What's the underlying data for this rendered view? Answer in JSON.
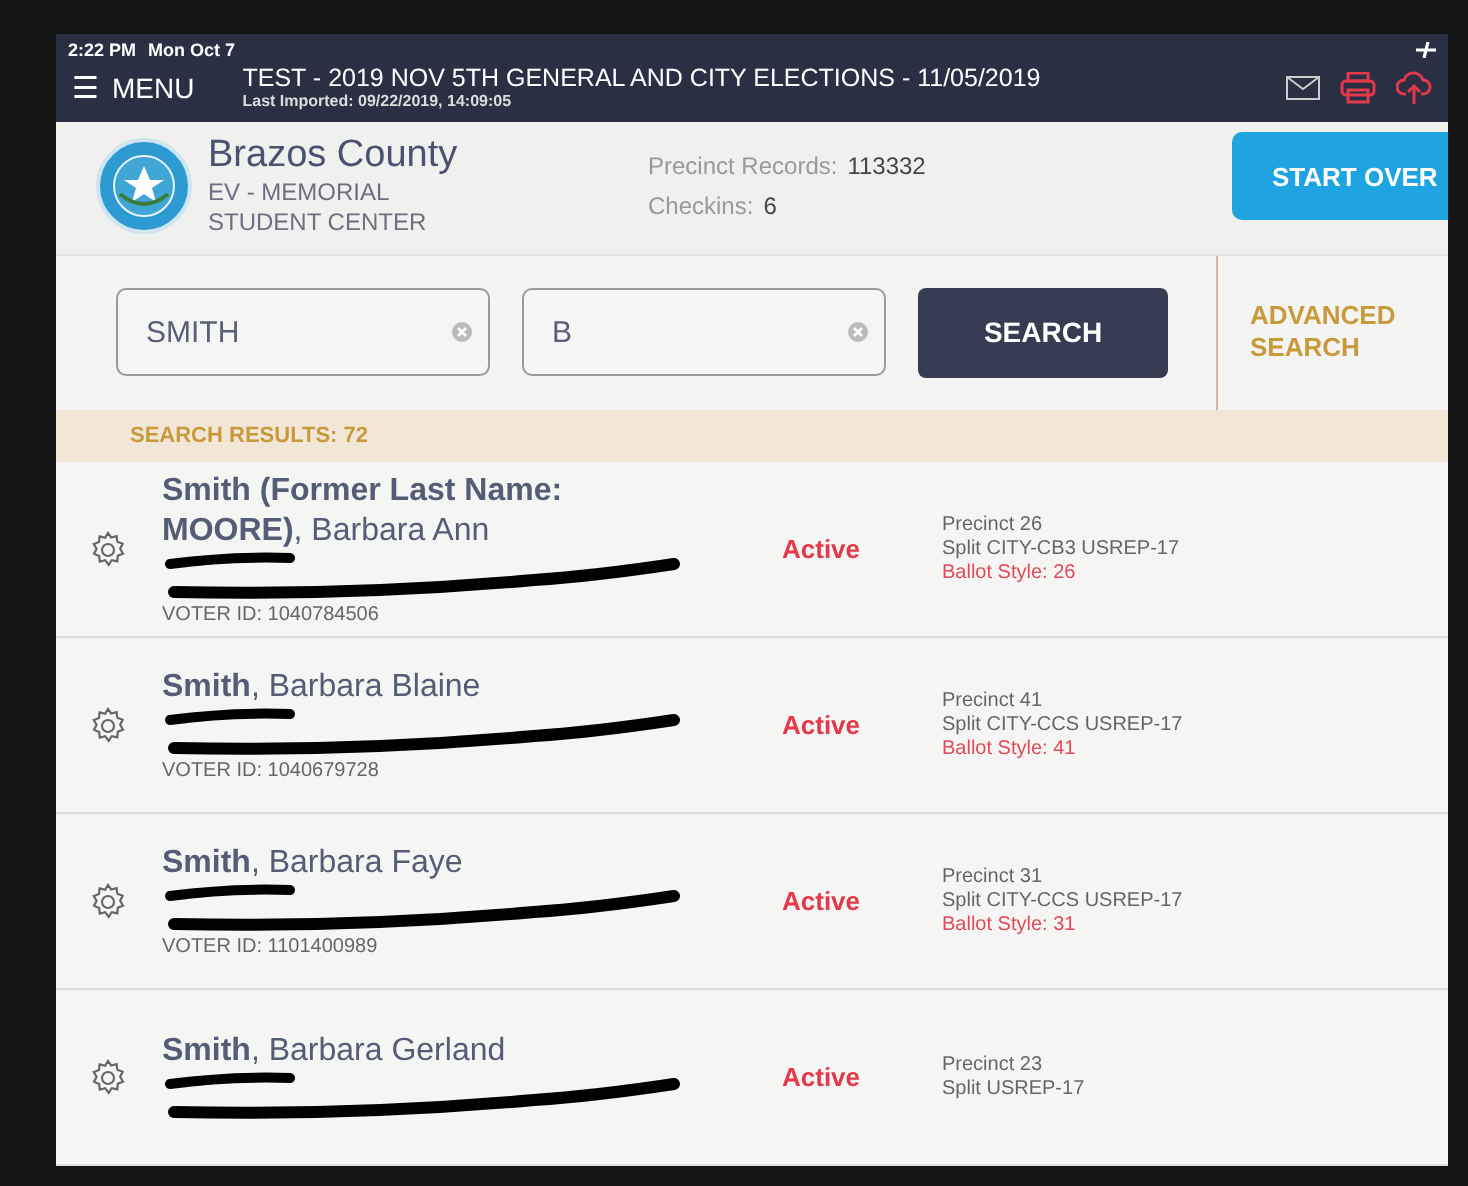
{
  "status_bar": {
    "time": "2:22 PM",
    "date": "Mon Oct 7"
  },
  "nav": {
    "menu_icon": "☰",
    "menu_label": "MENU",
    "title": "TEST - 2019 NOV 5TH GENERAL AND CITY ELECTIONS - 11/05/2019",
    "subtitle": "Last Imported: 09/22/2019, 14:09:05"
  },
  "header": {
    "county": "Brazos County",
    "location_lines": [
      "EV - MEMORIAL",
      "STUDENT CENTER"
    ],
    "stats": [
      {
        "label": "Precinct Records:",
        "value": "113332"
      },
      {
        "label": "Checkins:",
        "value": "6"
      }
    ],
    "start_over": "START OVER"
  },
  "search": {
    "fields": [
      {
        "value": "SMITH"
      },
      {
        "value": "B"
      }
    ],
    "button": "SEARCH",
    "advanced": "ADVANCED SEARCH"
  },
  "results_label": "SEARCH RESULTS: 72",
  "results": [
    {
      "name_bold": "Smith (Former Last Name: MOORE)",
      "name_rest": ", Barbara Ann",
      "voter_id": "VOTER ID: 1040784506",
      "status": "Active",
      "precinct": "Precinct 26",
      "split": "Split CITY-CB3 USREP-17",
      "ballot_style": "Ballot Style: 26"
    },
    {
      "name_bold": "Smith",
      "name_rest": ", Barbara Blaine",
      "voter_id": "VOTER ID: 1040679728",
      "status": "Active",
      "precinct": "Precinct 41",
      "split": "Split CITY-CCS USREP-17",
      "ballot_style": "Ballot Style: 41"
    },
    {
      "name_bold": "Smith",
      "name_rest": ", Barbara Faye",
      "voter_id": "VOTER ID: 1101400989",
      "status": "Active",
      "precinct": "Precinct 31",
      "split": "Split CITY-CCS USREP-17",
      "ballot_style": "Ballot Style: 31"
    },
    {
      "name_bold": "Smith",
      "name_rest": ", Barbara Gerland",
      "status": "Active",
      "precinct": "Precinct 23",
      "split": "Split USREP-17"
    }
  ]
}
